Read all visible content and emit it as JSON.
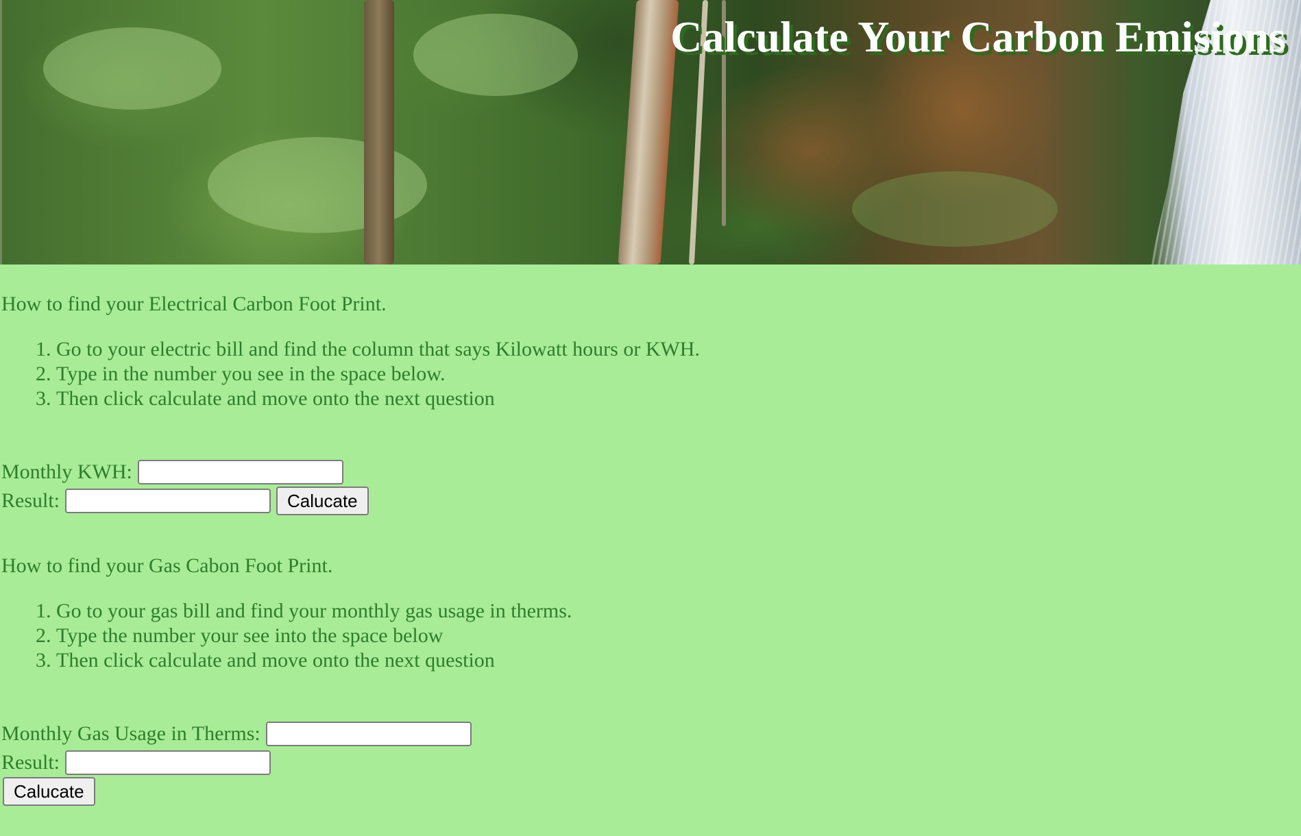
{
  "header": {
    "title": "Calculate Your Carbon Emisions"
  },
  "electric": {
    "intro": "How to find your Electrical Carbon Foot Print.",
    "steps": [
      "Go to your electric bill and find the column that says Kilowatt hours or KWH.",
      "Type in the number you see in the space below.",
      "Then click calculate and move onto the next question"
    ],
    "input_label": "Monthly KWH:",
    "input_value": "",
    "result_label": "Result:",
    "result_value": "",
    "button_label": "Calucate"
  },
  "gas": {
    "intro": "How to find your Gas Cabon Foot Print.",
    "steps": [
      "Go to your gas bill and find your monthly gas usage in therms.",
      "Type the number your see into the space below",
      "Then click calculate and move onto the next question"
    ],
    "input_label": "Monthly Gas Usage in Therms:",
    "input_value": "",
    "result_label": "Result:",
    "result_value": "",
    "button_label": "Calucate"
  },
  "colors": {
    "background": "#a8ec98",
    "text": "#2f7d2a",
    "title": "#ffffff",
    "title_shadow": "#2f6a1f"
  }
}
